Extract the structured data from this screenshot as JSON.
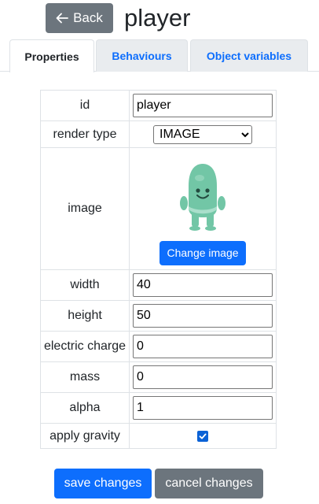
{
  "header": {
    "back_label": "Back",
    "title": "player"
  },
  "tabs": [
    {
      "label": "Properties",
      "active": true
    },
    {
      "label": "Behaviours",
      "active": false
    },
    {
      "label": "Object variables",
      "active": false
    }
  ],
  "properties": {
    "id": {
      "label": "id",
      "value": "player"
    },
    "render_type": {
      "label": "render type",
      "value": "IMAGE"
    },
    "image": {
      "label": "image",
      "change_label": "Change image"
    },
    "width": {
      "label": "width",
      "value": "40"
    },
    "height": {
      "label": "height",
      "value": "50"
    },
    "electric_charge": {
      "label": "electric charge",
      "value": "0"
    },
    "mass": {
      "label": "mass",
      "value": "0"
    },
    "alpha": {
      "label": "alpha",
      "value": "1"
    },
    "apply_gravity": {
      "label": "apply gravity",
      "checked": true
    }
  },
  "actions": {
    "save_label": "save changes",
    "cancel_label": "cancel changes"
  },
  "colors": {
    "primary": "#0d6efd",
    "secondary": "#6c757d",
    "sprite": "#72c6a6"
  },
  "icons": {
    "back": "arrow-left-icon",
    "dropdown": "chevron-down-icon",
    "check": "check-icon"
  }
}
